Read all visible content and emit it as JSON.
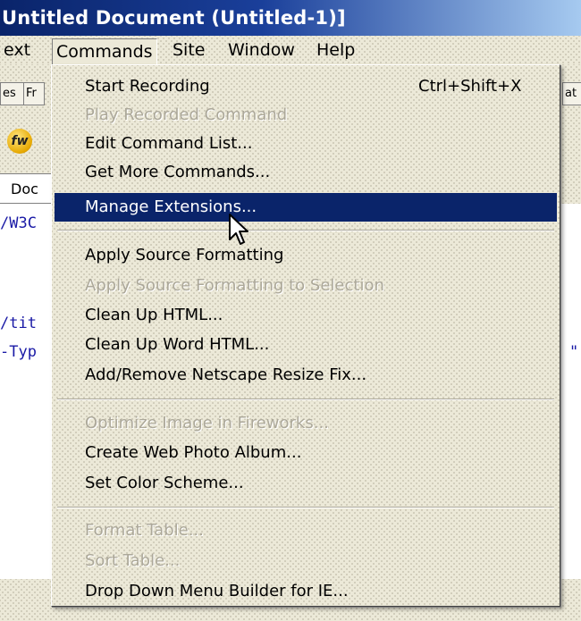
{
  "window": {
    "title": "Untitled Document (Untitled-1)]"
  },
  "menubar": {
    "items": [
      {
        "label": "ext"
      },
      {
        "label": "Commands"
      },
      {
        "label": "Site"
      },
      {
        "label": "Window"
      },
      {
        "label": "Help"
      }
    ]
  },
  "background": {
    "tab_left": "es",
    "tab_left2": "Fr",
    "tab_right": "at",
    "doc_tab": "Doc",
    "code_lines": [
      "/W3C",
      "/tit",
      "-Typ"
    ],
    "code_right": "\""
  },
  "commands_menu": {
    "items": [
      {
        "label": "Start Recording",
        "shortcut": "Ctrl+Shift+X"
      },
      {
        "label": "Play Recorded Command"
      },
      {
        "label": "Edit Command List..."
      },
      {
        "label": "Get More Commands..."
      },
      {
        "label": "Manage Extensions..."
      },
      {
        "label": "Apply Source Formatting"
      },
      {
        "label": "Apply Source Formatting to Selection"
      },
      {
        "label": "Clean Up HTML..."
      },
      {
        "label": "Clean Up Word HTML..."
      },
      {
        "label": "Add/Remove Netscape Resize Fix..."
      },
      {
        "label": "Optimize Image in Fireworks..."
      },
      {
        "label": "Create Web Photo Album..."
      },
      {
        "label": "Set Color Scheme..."
      },
      {
        "label": "Format Table..."
      },
      {
        "label": "Sort Table..."
      },
      {
        "label": "Drop Down Menu Builder for IE..."
      }
    ],
    "highlighted": "Manage Extensions...",
    "disabled": [
      "Play Recorded Command",
      "Apply Source Formatting to Selection",
      "Optimize Image in Fireworks...",
      "Format Table...",
      "Sort Table..."
    ]
  },
  "colors": {
    "highlight": "#0a246a",
    "menu_bg": "#ece9d8",
    "disabled_text": "#aca899",
    "code_text": "#1a1aa6"
  },
  "icons": {
    "cursor": "arrow-cursor",
    "app_icon": "fireworks-icon"
  }
}
